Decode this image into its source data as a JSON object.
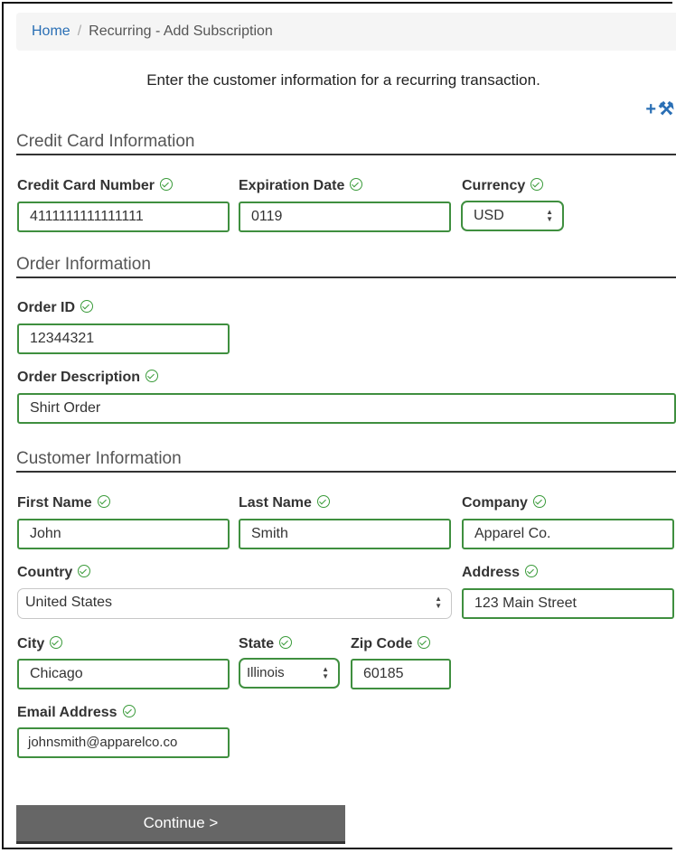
{
  "breadcrumb": {
    "home": "Home",
    "separator": "/",
    "current": "Recurring - Add Subscription"
  },
  "intro_text": "Enter the customer information for a recurring transaction.",
  "tools": {
    "add_icon": "plus-icon",
    "settings_icon": "wrench-icon"
  },
  "colors": {
    "link": "#2a6fb5",
    "valid_border": "#3f8f3f",
    "valid_check": "#3a9b3a",
    "button": "#666666"
  },
  "sections": {
    "credit_card": "Credit Card Information",
    "order": "Order Information",
    "customer": "Customer Information"
  },
  "fields": {
    "card_number": {
      "label": "Credit Card Number",
      "value": "4111111111111111"
    },
    "expiration": {
      "label": "Expiration Date",
      "value": "0119"
    },
    "currency": {
      "label": "Currency",
      "value": "USD"
    },
    "order_id": {
      "label": "Order ID",
      "value": "12344321"
    },
    "order_description": {
      "label": "Order Description",
      "value": "Shirt Order"
    },
    "first_name": {
      "label": "First Name",
      "value": "John"
    },
    "last_name": {
      "label": "Last Name",
      "value": "Smith"
    },
    "company": {
      "label": "Company",
      "value": "Apparel Co."
    },
    "country": {
      "label": "Country",
      "value": "United States"
    },
    "address": {
      "label": "Address",
      "value": "123 Main Street"
    },
    "city": {
      "label": "City",
      "value": "Chicago"
    },
    "state": {
      "label": "State",
      "value": "Illinois"
    },
    "zip": {
      "label": "Zip Code",
      "value": "60185"
    },
    "email": {
      "label": "Email Address",
      "value": "johnsmith@apparelco.co"
    }
  },
  "continue_label": "Continue >"
}
